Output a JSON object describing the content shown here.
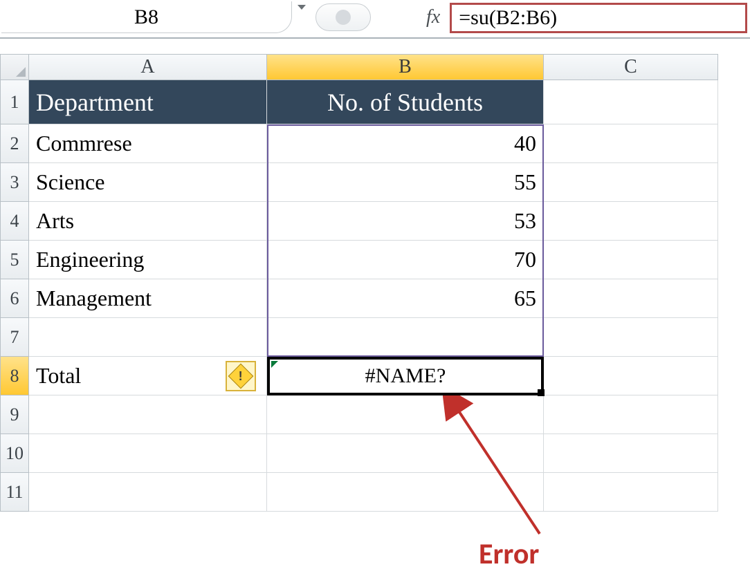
{
  "formula_bar": {
    "cell_ref": "B8",
    "fx_label": "fx",
    "formula": "=su(B2:B6)"
  },
  "columns": {
    "A": "A",
    "B": "B",
    "C": "C"
  },
  "row_numbers": [
    "1",
    "2",
    "3",
    "4",
    "5",
    "6",
    "7",
    "8",
    "9",
    "10",
    "11"
  ],
  "header": {
    "A": "Department",
    "B": "No. of Students"
  },
  "data_rows": [
    {
      "dept": "Commrese",
      "count": "40"
    },
    {
      "dept": "Science",
      "count": "55"
    },
    {
      "dept": "Arts",
      "count": "53"
    },
    {
      "dept": "Engineering",
      "count": "70"
    },
    {
      "dept": "Management",
      "count": "65"
    }
  ],
  "total_row": {
    "label": "Total",
    "value": "#NAME?"
  },
  "annotation": {
    "error_label": "Error"
  },
  "selected": {
    "row": 8,
    "col": "B",
    "range_highlight": "B2:B7"
  }
}
